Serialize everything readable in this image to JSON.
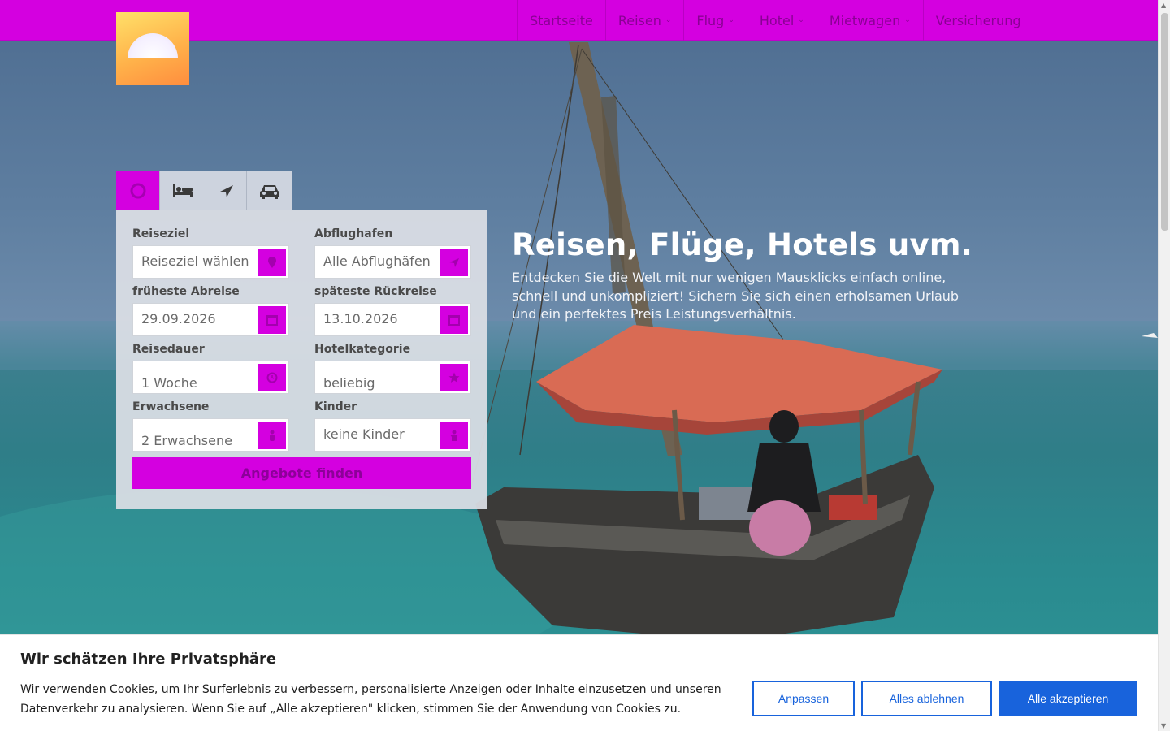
{
  "brand": {
    "logo_alt": "logo"
  },
  "nav": {
    "items": [
      {
        "label": "Startseite",
        "dropdown": false
      },
      {
        "label": "Reisen",
        "dropdown": true
      },
      {
        "label": "Flug",
        "dropdown": true
      },
      {
        "label": "Hotel",
        "dropdown": true
      },
      {
        "label": "Mietwagen",
        "dropdown": true
      },
      {
        "label": "Versicherung",
        "dropdown": false
      }
    ]
  },
  "search": {
    "tabs": [
      {
        "name": "travel",
        "icon": "globe-icon",
        "active": true
      },
      {
        "name": "hotel",
        "icon": "bed-icon",
        "active": false
      },
      {
        "name": "flight",
        "icon": "plane-icon",
        "active": false
      },
      {
        "name": "car",
        "icon": "car-icon",
        "active": false
      }
    ],
    "fields": {
      "destination": {
        "label": "Reiseziel",
        "value": "Reiseziel wählen",
        "icon": "map-marker-icon"
      },
      "airport": {
        "label": "Abflughafen",
        "value": "Alle Abflughäfen",
        "icon": "plane-icon"
      },
      "earliest": {
        "label": "früheste Abreise",
        "value": "29.09.2026",
        "icon": "calendar-icon"
      },
      "latest": {
        "label": "späteste Rückreise",
        "value": "13.10.2026",
        "icon": "calendar-icon"
      },
      "duration": {
        "label": "Reisedauer",
        "value": "1 Woche",
        "icon": "clock-icon"
      },
      "category": {
        "label": "Hotelkategorie",
        "value": "beliebig",
        "icon": "star-icon"
      },
      "adults": {
        "label": "Erwachsene",
        "value": "2 Erwachsene",
        "icon": "person-icon"
      },
      "children": {
        "label": "Kinder",
        "value": "keine Kinder",
        "icon": "child-icon"
      }
    },
    "submit_label": "Angebote finden"
  },
  "hero": {
    "title": "Reisen, Flüge, Hotels uvm.",
    "subtitle": "Entdecken Sie die Welt mit nur wenigen Mausklicks einfach online, schnell und unkompliziert! Sichern Sie sich einen erholsamen Urlaub und ein perfektes Preis Leistungsverhältnis."
  },
  "cookie": {
    "title": "Wir schätzen Ihre Privatsphäre",
    "text": "Wir verwenden Cookies, um Ihr Surferlebnis zu verbessern, personalisierte Anzeigen oder Inhalte einzusetzen und unseren Datenverkehr zu analysieren. Wenn Sie auf „Alle akzeptieren\" klicken, stimmen Sie der Anwendung von Cookies zu.",
    "customize_label": "Anpassen",
    "reject_label": "Alles ablehnen",
    "accept_label": "Alle akzeptieren"
  },
  "colors": {
    "accent": "#d400e0",
    "cookie_button": "#1863dc"
  }
}
